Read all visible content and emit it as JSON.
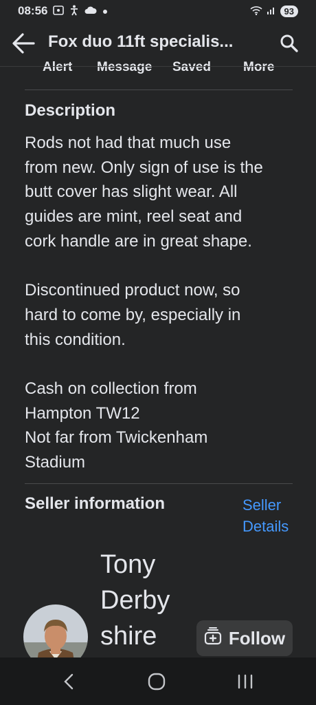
{
  "status_bar": {
    "time": "08:56",
    "icons": [
      "screenshot-icon",
      "accessibility-icon",
      "cloud-icon",
      "dot-icon",
      "wifi-icon",
      "signal-icon"
    ],
    "battery": "93"
  },
  "app_bar": {
    "title": "Fox duo 11ft specialis...",
    "back_icon": "back-arrow-icon",
    "search_icon": "search-icon"
  },
  "actions": [
    "Alert",
    "Message",
    "Saved",
    "More"
  ],
  "description": {
    "heading": "Description",
    "lines": [
      "Rods not had that much use",
      "from new. Only sign of use is the",
      "butt cover has slight wear. All",
      "guides are mint, reel seat and",
      "cork handle are in great shape.",
      "",
      "Discontinued product now, so",
      "hard to come by, especially in",
      "this condition.",
      "",
      "Cash on collection from",
      "Hampton TW12",
      "Not far from Twickenham",
      "Stadium"
    ]
  },
  "seller": {
    "heading": "Seller information",
    "details_link": [
      "Seller",
      "Details"
    ],
    "name_lines": [
      "Tony",
      "Derby",
      "shire"
    ],
    "follow_label": "Follow",
    "follow_icon": "add-to-inbox-icon",
    "avatar": "avatar"
  },
  "nav_bar": {
    "icons": [
      "nav-back-icon",
      "nav-home-icon",
      "nav-recents-icon"
    ]
  },
  "colors": {
    "background": "#242526",
    "text": "#e4e6eb",
    "link": "#4599ff",
    "button": "#3a3b3c"
  }
}
